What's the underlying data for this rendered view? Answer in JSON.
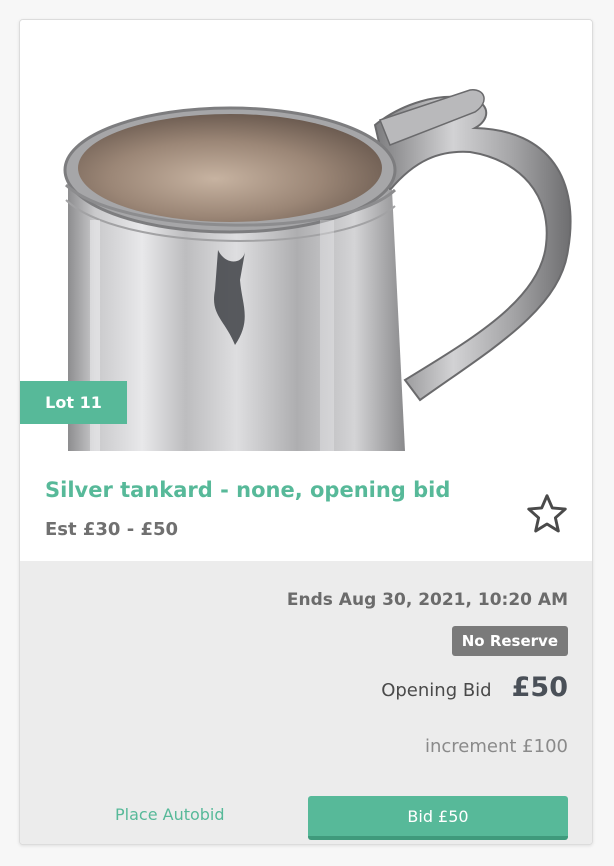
{
  "lot": {
    "badge": "Lot 11",
    "title": "Silver tankard - none, opening bid",
    "estimate": "Est £30 - £50"
  },
  "bid_info": {
    "ends": "Ends Aug 30, 2021, 10:20 AM",
    "reserve_badge": "No Reserve",
    "opening_bid_label": "Opening Bid",
    "opening_bid_value": "£50",
    "increment": "increment £100"
  },
  "actions": {
    "autobid_label": "Place Autobid",
    "bid_button_label": "Bid £50"
  },
  "icons": {
    "favorite": "star-icon"
  },
  "colors": {
    "accent": "#57b999",
    "reserve_badge": "#7a7a7a",
    "panel_bg": "#ececec"
  }
}
